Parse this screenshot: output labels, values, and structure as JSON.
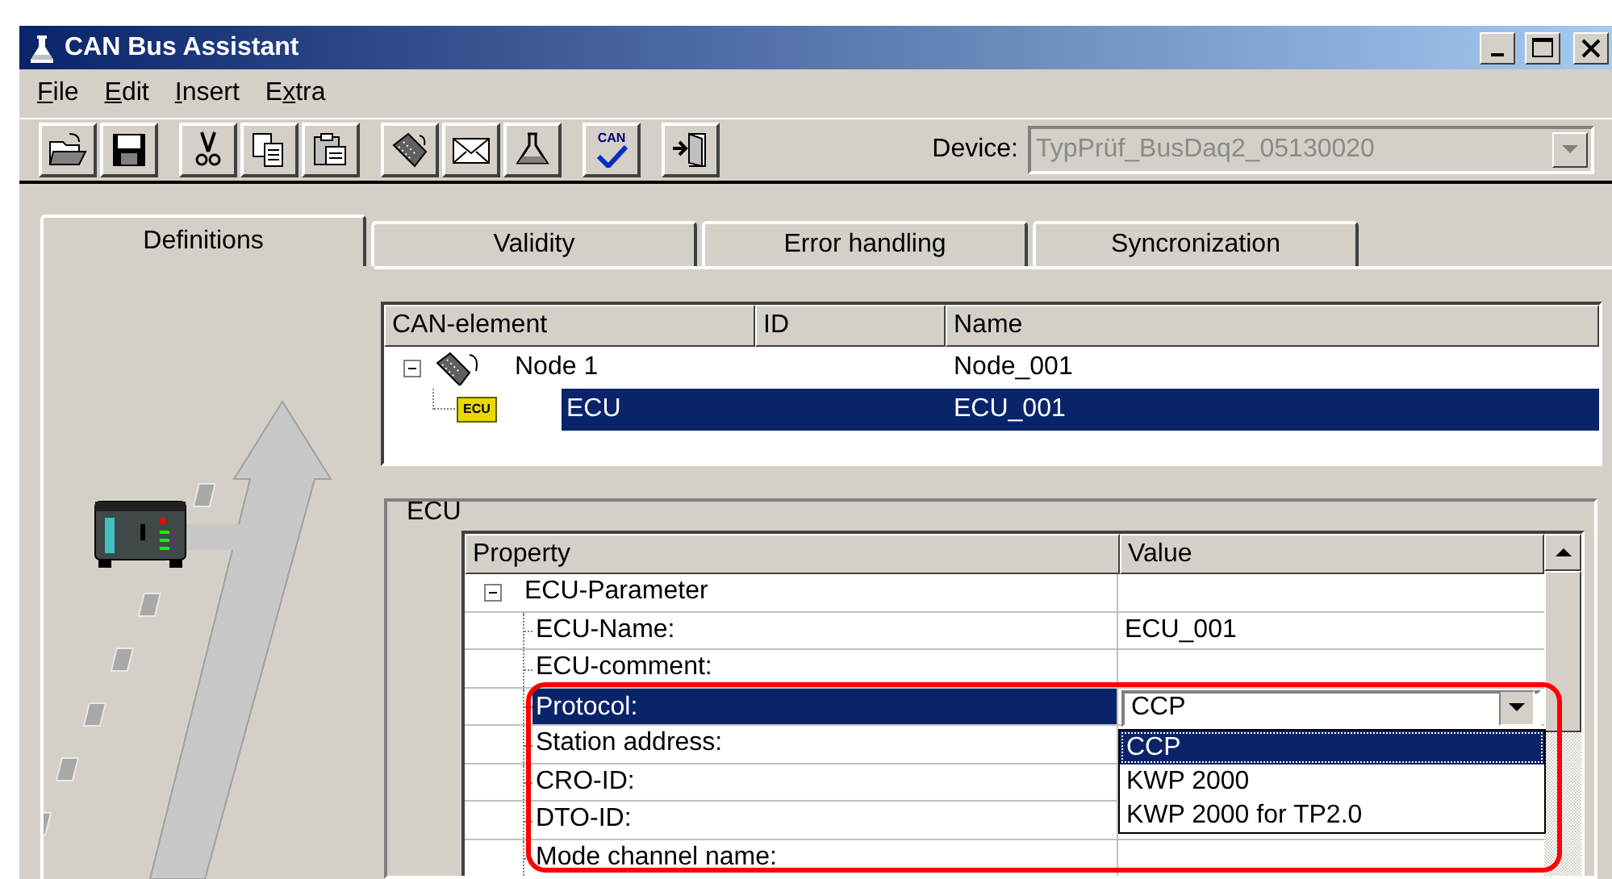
{
  "window": {
    "title": "CAN Bus Assistant"
  },
  "menu": [
    {
      "key": "F",
      "rest": "ile"
    },
    {
      "key": "E",
      "rest": "dit"
    },
    {
      "key": "I",
      "rest": "nsert"
    },
    {
      "lead": "E",
      "key": "x",
      "rest": "tra"
    }
  ],
  "toolbar": [
    [
      {
        "kind": "open"
      },
      {
        "kind": "save"
      }
    ],
    [
      {
        "kind": "cut"
      },
      {
        "kind": "copy"
      },
      {
        "kind": "paste"
      }
    ],
    [
      {
        "kind": "node"
      },
      {
        "kind": "mail"
      },
      {
        "kind": "flask"
      }
    ],
    [
      {
        "kind": "check",
        "label": "CAN"
      }
    ],
    [
      {
        "kind": "exit"
      }
    ]
  ],
  "device": {
    "label": "Device:",
    "value": "TypPrüf_BusDaq2_05130020",
    "disabled": true
  },
  "tabs": [
    {
      "label": "Definitions",
      "selected": true
    },
    {
      "label": "Validity",
      "selected": false
    },
    {
      "label": "Error handling",
      "selected": false
    },
    {
      "label": "Syncronization",
      "selected": false
    }
  ],
  "tree_table": {
    "columns": [
      "CAN-element",
      "ID",
      "Name"
    ],
    "rows": [
      {
        "label": "Node 1",
        "kind": "node",
        "name": "Node_001",
        "expanded": true,
        "selected": false,
        "children": [
          {
            "label": "ECU",
            "kind": "ecu",
            "icon_label": "ECU",
            "name": "ECU_001",
            "selected": true
          }
        ]
      }
    ]
  },
  "ecu_group": {
    "title": "ECU",
    "property_grid": {
      "columns": [
        "Property",
        "Value"
      ],
      "rows": [
        {
          "label": "ECU-Parameter",
          "expanded": true,
          "selected": false,
          "children": [
            {
              "label": "ECU-Name:",
              "value": "ECU_001",
              "selected": false
            },
            {
              "label": "ECU-comment:",
              "selected": false
            },
            {
              "label": "Protocol:",
              "kind": "combo",
              "value": "CCP",
              "selected": true,
              "open": true,
              "options": [
                {
                  "label": "CCP",
                  "selected": true
                },
                {
                  "label": "KWP 2000",
                  "selected": false
                },
                {
                  "label": "KWP 2000 for TP2.0",
                  "selected": false
                }
              ]
            },
            {
              "label": "Station address:",
              "selected": false
            },
            {
              "label": "CRO-ID:",
              "selected": false
            },
            {
              "label": "DTO-ID:",
              "selected": false
            },
            {
              "label": "Mode channel name:",
              "selected": false
            }
          ]
        }
      ]
    },
    "highlight": true
  }
}
